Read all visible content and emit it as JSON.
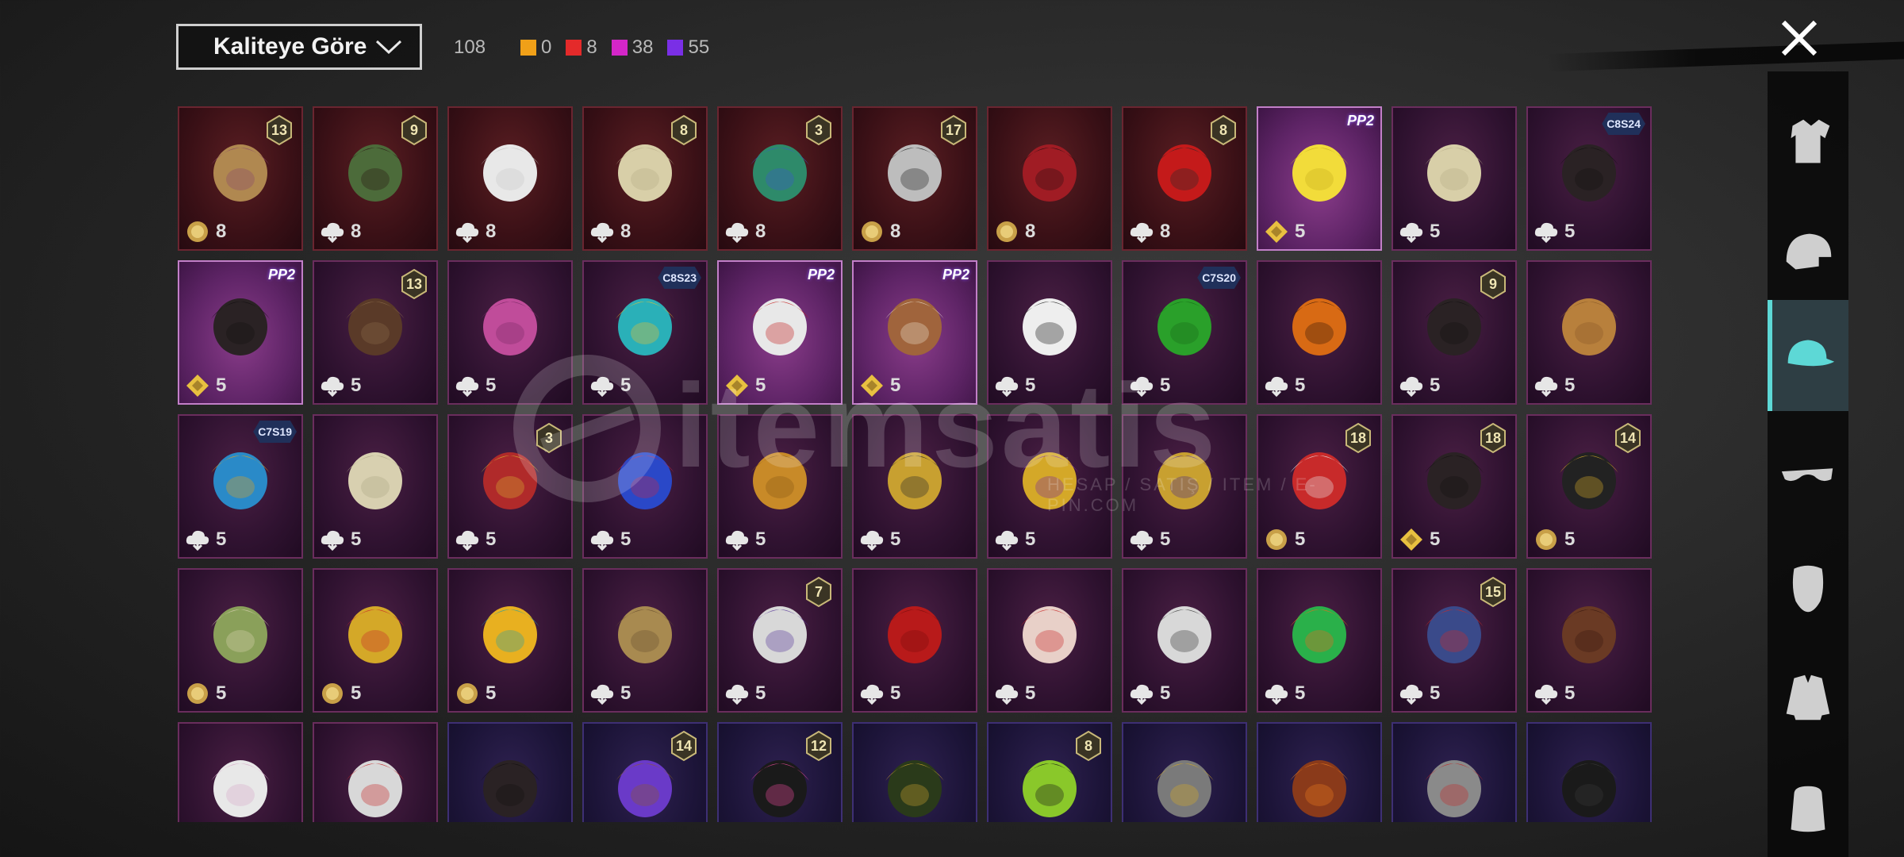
{
  "toolbar": {
    "sort_label": "Kaliteye Göre",
    "total_count": "108",
    "counts": [
      {
        "name": "gold",
        "color": "#f0a018",
        "value": "0"
      },
      {
        "name": "red",
        "color": "#e42a2a",
        "value": "8"
      },
      {
        "name": "magenta",
        "color": "#d426c8",
        "value": "38"
      },
      {
        "name": "purple",
        "color": "#7a2fe6",
        "value": "55"
      }
    ]
  },
  "colors": {
    "active_category": "#5dd8d6"
  },
  "watermark": {
    "text": "itemsatis",
    "subtitle": "HESAP / SATIŞ / ITEM / E-PIN.COM"
  },
  "sidebar": {
    "categories": [
      {
        "name": "outfit",
        "icon": "outfit-icon",
        "active": false
      },
      {
        "name": "helmet",
        "icon": "helmet-icon",
        "active": false
      },
      {
        "name": "hat",
        "icon": "cap-icon",
        "active": true
      },
      {
        "name": "eyewear",
        "icon": "glasses-icon",
        "active": false
      },
      {
        "name": "mask",
        "icon": "mask-icon",
        "active": false
      },
      {
        "name": "top",
        "icon": "jacket-icon",
        "active": false
      },
      {
        "name": "backpack",
        "icon": "backpack-icon",
        "active": false
      }
    ]
  },
  "items": [
    {
      "bg": "red",
      "art": "hat-straw",
      "badge": "13",
      "dup_icon": "coin-icon",
      "count": "8"
    },
    {
      "bg": "red",
      "art": "zombie-head",
      "badge": "9",
      "dup_icon": "cloud-icon",
      "count": "8"
    },
    {
      "bg": "red",
      "art": "cowboy-hat",
      "badge": "",
      "dup_icon": "cloud-icon",
      "count": "8"
    },
    {
      "bg": "red",
      "art": "wig-blonde",
      "badge": "8",
      "dup_icon": "cloud-icon",
      "count": "8"
    },
    {
      "bg": "red",
      "art": "curly-green",
      "badge": "3",
      "dup_icon": "cloud-icon",
      "count": "8"
    },
    {
      "bg": "red",
      "art": "silver-hair",
      "badge": "17",
      "dup_icon": "coin-icon",
      "count": "8"
    },
    {
      "bg": "red",
      "art": "red-helmet",
      "badge": "",
      "dup_icon": "coin-icon",
      "count": "8"
    },
    {
      "bg": "red",
      "art": "witch-hat",
      "badge": "8",
      "dup_icon": "cloud-icon",
      "count": "8"
    },
    {
      "bg": "lav",
      "art": "yellow-box",
      "pp": "PP2",
      "dup_icon": "diamond-icon",
      "count": "5"
    },
    {
      "bg": "pink",
      "art": "wig-blonde",
      "badge": "",
      "dup_icon": "cloud-icon",
      "count": "5"
    },
    {
      "bg": "pink",
      "art": "black-hair",
      "season": "C8S24",
      "dup_icon": "cloud-icon",
      "count": "5"
    },
    {
      "bg": "lav",
      "art": "black-hair",
      "pp": "PP2",
      "dup_icon": "diamond-icon",
      "count": "5"
    },
    {
      "bg": "pink",
      "art": "goggles-cap",
      "badge": "13",
      "dup_icon": "cloud-icon",
      "count": "5"
    },
    {
      "bg": "pink",
      "art": "pink-hair",
      "badge": "",
      "dup_icon": "cloud-icon",
      "count": "5"
    },
    {
      "bg": "pink",
      "art": "cat-headphones",
      "season": "C8S23",
      "dup_icon": "cloud-icon",
      "count": "5"
    },
    {
      "bg": "lav",
      "art": "cap-sunglasses",
      "pp": "PP2",
      "dup_icon": "diamond-icon",
      "count": "5"
    },
    {
      "bg": "lav",
      "art": "dog-head",
      "pp": "PP2",
      "dup_icon": "diamond-icon",
      "count": "5"
    },
    {
      "bg": "pink",
      "art": "panda-head",
      "badge": "",
      "dup_icon": "cloud-icon",
      "count": "5"
    },
    {
      "bg": "pink",
      "art": "green-hair",
      "season": "C7S20",
      "dup_icon": "cloud-icon",
      "count": "5"
    },
    {
      "bg": "pink",
      "art": "pumpkin",
      "badge": "",
      "dup_icon": "cloud-icon",
      "count": "5"
    },
    {
      "bg": "pink",
      "art": "black-hair",
      "badge": "9",
      "dup_icon": "cloud-icon",
      "count": "5"
    },
    {
      "bg": "pink",
      "art": "ginger-hair",
      "badge": "",
      "dup_icon": "cloud-icon",
      "count": "5"
    },
    {
      "bg": "pink",
      "art": "feather-head",
      "season": "C7S19",
      "dup_icon": "cloud-icon",
      "count": "5"
    },
    {
      "bg": "pink",
      "art": "curly-blonde",
      "badge": "",
      "dup_icon": "cloud-icon",
      "count": "5"
    },
    {
      "bg": "pink",
      "art": "jester-hat",
      "badge": "3",
      "dup_icon": "cloud-icon",
      "count": "5"
    },
    {
      "bg": "pink",
      "art": "blue-mask",
      "badge": "",
      "dup_icon": "cloud-icon",
      "count": "5"
    },
    {
      "bg": "pink",
      "art": "potato-head",
      "badge": "",
      "dup_icon": "cloud-icon",
      "count": "5"
    },
    {
      "bg": "pink",
      "art": "gold-mask",
      "badge": "",
      "dup_icon": "cloud-icon",
      "count": "5"
    },
    {
      "bg": "pink",
      "art": "gold-helmet",
      "badge": "",
      "dup_icon": "cloud-icon",
      "count": "5"
    },
    {
      "bg": "pink",
      "art": "lion-mask",
      "badge": "",
      "dup_icon": "cloud-icon",
      "count": "5"
    },
    {
      "bg": "pink",
      "art": "uncle-hat",
      "badge": "18",
      "dup_icon": "coin-icon",
      "count": "5"
    },
    {
      "bg": "pink",
      "art": "black-hair",
      "badge": "18",
      "dup_icon": "diamond-icon",
      "count": "5"
    },
    {
      "bg": "pink",
      "art": "gold-band",
      "badge": "14",
      "dup_icon": "coin-icon",
      "count": "5"
    },
    {
      "bg": "pink",
      "art": "green-bonnet",
      "badge": "",
      "dup_icon": "coin-icon",
      "count": "5"
    },
    {
      "bg": "pink",
      "art": "rooster-crest",
      "badge": "",
      "dup_icon": "coin-icon",
      "count": "5"
    },
    {
      "bg": "pink",
      "art": "duck-hat",
      "badge": "",
      "dup_icon": "coin-icon",
      "count": "5"
    },
    {
      "bg": "pink",
      "art": "flat-straw",
      "badge": "",
      "dup_icon": "cloud-icon",
      "count": "5"
    },
    {
      "bg": "pink",
      "art": "crown-veil",
      "badge": "7",
      "dup_icon": "cloud-icon",
      "count": "5"
    },
    {
      "bg": "pink",
      "art": "red-braid",
      "badge": "",
      "dup_icon": "cloud-icon",
      "count": "5"
    },
    {
      "bg": "pink",
      "art": "unicorn-head",
      "badge": "",
      "dup_icon": "cloud-icon",
      "count": "5"
    },
    {
      "bg": "pink",
      "art": "dreadlock-mask",
      "badge": "",
      "dup_icon": "cloud-icon",
      "count": "5"
    },
    {
      "bg": "pink",
      "art": "frog-cap",
      "badge": "",
      "dup_icon": "cloud-icon",
      "count": "5"
    },
    {
      "bg": "pink",
      "art": "robot-helmet",
      "badge": "15",
      "dup_icon": "cloud-icon",
      "count": "5"
    },
    {
      "bg": "pink",
      "art": "bear-head",
      "badge": "",
      "dup_icon": "cloud-icon",
      "count": "5"
    },
    {
      "bg": "pink",
      "art": "sun-hat",
      "badge": ""
    },
    {
      "bg": "pink",
      "art": "chicken-head",
      "badge": ""
    },
    {
      "bg": "blue",
      "art": "black-hair",
      "badge": ""
    },
    {
      "bg": "blue",
      "art": "purple-cap",
      "badge": "14"
    },
    {
      "bg": "blue",
      "art": "bunny-helmet",
      "badge": "12"
    },
    {
      "bg": "blue",
      "art": "officer-cap",
      "badge": ""
    },
    {
      "bg": "blue",
      "art": "green-skull",
      "badge": "8"
    },
    {
      "bg": "blue",
      "art": "visor-helmet",
      "badge": ""
    },
    {
      "bg": "blue",
      "art": "aviator-hair",
      "badge": ""
    },
    {
      "bg": "blue",
      "art": "bucket-hat",
      "badge": ""
    },
    {
      "bg": "blue",
      "art": "black-cap",
      "badge": ""
    }
  ]
}
